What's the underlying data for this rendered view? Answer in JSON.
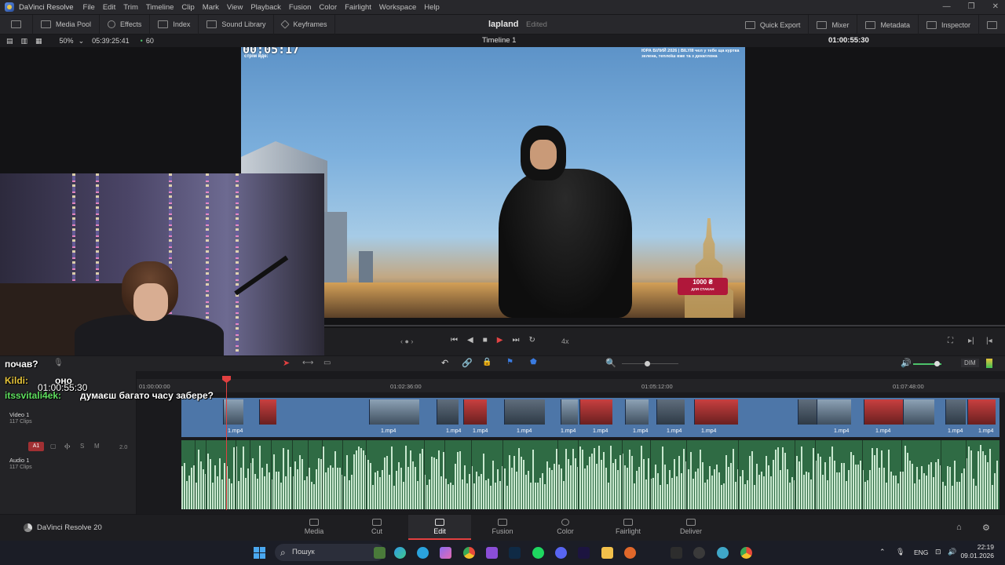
{
  "app": {
    "name": "DaVinci Resolve",
    "menu": [
      "File",
      "Edit",
      "Trim",
      "Timeline",
      "Clip",
      "Mark",
      "View",
      "Playback",
      "Fusion",
      "Color",
      "Fairlight",
      "Workspace",
      "Help"
    ]
  },
  "toolbar": {
    "left": [
      "Media Pool",
      "Effects",
      "Index",
      "Sound Library",
      "Keyframes"
    ],
    "right": [
      "Quick Export",
      "Mixer",
      "Metadata",
      "Inspector"
    ],
    "project_title": "lapland",
    "project_status": "Edited"
  },
  "viewerbar": {
    "zoom": "50%",
    "duration": "05:39:25:41",
    "fps": "60",
    "timeline_name": "Timeline 1",
    "timecode": "01:00:55:30"
  },
  "video_overlay": {
    "clock": "00:05:17",
    "clock_label": "стрім йде:",
    "chat": "ЮРА БІЛИЙ 2026 | BILYIII чел у тебе ща куртка зелена, теплоїш вже та з декатлона",
    "badge_amount": "1000 ₴",
    "badge_caption": "ДЛЯ СТАКАН"
  },
  "transport": {
    "speed": "4x"
  },
  "timeline": {
    "ruler": [
      "01:00:00:00",
      "01:02:36:00",
      "01:05:12:00",
      "01:07:48:00"
    ],
    "video_track": {
      "name": "Video 1",
      "clips": "117 Clips",
      "clip_label": "1.mp4"
    },
    "audio_track": {
      "name": "Audio 1",
      "clips": "117 Clips",
      "badge": "A1",
      "level": "2.0"
    },
    "dim_label": "DIM"
  },
  "stream_chat": {
    "line1": "почав?",
    "line2_user": "Kildi:",
    "line2_text": "оно",
    "timecode_overlay": "01:00:55:30",
    "line3_user": "itssvitali4ek:",
    "line3_text": "думаєш багато часу забере?"
  },
  "pages": {
    "brand": "DaVinci Resolve 20",
    "tabs": [
      "Media",
      "Cut",
      "Edit",
      "Fusion",
      "Color",
      "Fairlight",
      "Deliver"
    ],
    "active": "Edit"
  },
  "taskbar": {
    "search": "Пошук",
    "lang": "ENG",
    "time": "22:19",
    "date": "09.01.2026"
  },
  "colors": {
    "accent": "#e24040",
    "video_clip": "#4d76a8",
    "audio_clip": "#2f6b44"
  }
}
